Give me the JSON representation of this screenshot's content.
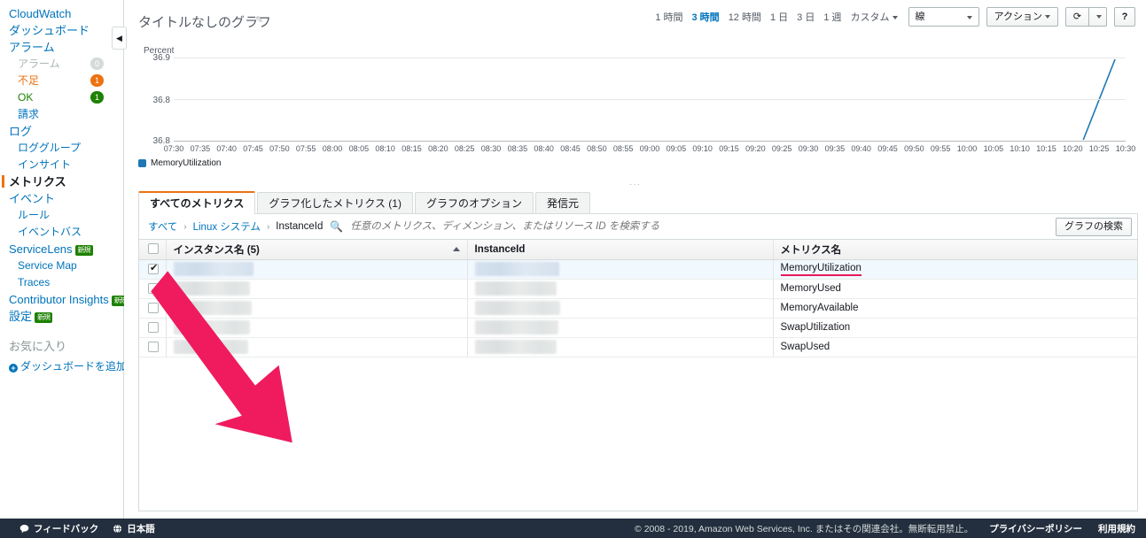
{
  "sidebar": {
    "items": [
      {
        "label": "CloudWatch",
        "level": 1,
        "style": "link"
      },
      {
        "label": "ダッシュボード",
        "level": 1,
        "style": "link"
      },
      {
        "label": "アラーム",
        "level": 1,
        "style": "link"
      },
      {
        "label": "アラーム",
        "level": 2,
        "style": "muted",
        "badge": "0",
        "badge_color": "gray"
      },
      {
        "label": "不足",
        "level": 2,
        "style": "warn",
        "badge": "1",
        "badge_color": "orange"
      },
      {
        "label": "OK",
        "level": 2,
        "style": "ok",
        "badge": "1",
        "badge_color": "green"
      },
      {
        "label": "請求",
        "level": 2,
        "style": "link"
      },
      {
        "label": "ログ",
        "level": 1,
        "style": "link"
      },
      {
        "label": "ロググループ",
        "level": 2,
        "style": "link"
      },
      {
        "label": "インサイト",
        "level": 2,
        "style": "link"
      },
      {
        "label": "メトリクス",
        "level": 1,
        "style": "current"
      },
      {
        "label": "イベント",
        "level": 1,
        "style": "link"
      },
      {
        "label": "ルール",
        "level": 2,
        "style": "link"
      },
      {
        "label": "イベントバス",
        "level": 2,
        "style": "link"
      },
      {
        "label": "ServiceLens",
        "level": 1,
        "style": "link",
        "tag": "新規"
      },
      {
        "label": "Service Map",
        "level": 2,
        "style": "link"
      },
      {
        "label": "Traces",
        "level": 2,
        "style": "link"
      },
      {
        "label": "Contributor Insights",
        "level": 1,
        "style": "link",
        "tag": "新規"
      },
      {
        "label": "設定",
        "level": 1,
        "style": "link",
        "tag": "新規"
      }
    ],
    "favorites_title": "お気に入り",
    "add_dashboard": "ダッシュボードを追加",
    "collapse_icon": "chevron-left-icon"
  },
  "header": {
    "graph_title": "タイトルなしのグラフ",
    "edit_icon": "pencil-icon",
    "ranges": [
      {
        "label": "1 時間",
        "selected": false
      },
      {
        "label": "3 時間",
        "selected": true
      },
      {
        "label": "12 時間",
        "selected": false
      },
      {
        "label": "1 日",
        "selected": false
      },
      {
        "label": "3 日",
        "selected": false
      },
      {
        "label": "1 週",
        "selected": false
      }
    ],
    "custom_label": "カスタム",
    "graph_type": "線",
    "actions_label": "アクション",
    "refresh_icon": "refresh-icon",
    "help_label": "?"
  },
  "chart_data": {
    "type": "line",
    "title": "タイトルなしのグラフ",
    "ylabel": "Percent",
    "xlabel": "",
    "ytick_labels": [
      "36.9",
      "36.8",
      "36.8"
    ],
    "ylim": [
      36.8,
      36.9
    ],
    "grid": true,
    "legend_position": "bottom-left",
    "categories": [
      "07:30",
      "07:35",
      "07:40",
      "07:45",
      "07:50",
      "07:55",
      "08:00",
      "08:05",
      "08:10",
      "08:15",
      "08:20",
      "08:25",
      "08:30",
      "08:35",
      "08:40",
      "08:45",
      "08:50",
      "08:55",
      "09:00",
      "09:05",
      "09:10",
      "09:15",
      "09:20",
      "09:25",
      "09:30",
      "09:35",
      "09:40",
      "09:45",
      "09:50",
      "09:55",
      "10:00",
      "10:05",
      "10:10",
      "10:15",
      "10:20",
      "10:25",
      "10:30"
    ],
    "series": [
      {
        "name": "MemoryUtilization",
        "color": "#1f77b4",
        "x": [
          "10:22",
          "10:28"
        ],
        "values": [
          36.8,
          36.9
        ]
      }
    ]
  },
  "legend": {
    "label": "MemoryUtilization",
    "color": "#1f77b4"
  },
  "dots": "···",
  "tabs": [
    {
      "label": "すべてのメトリクス",
      "active": true
    },
    {
      "label": "グラフ化したメトリクス (1)",
      "active": false
    },
    {
      "label": "グラフのオプション",
      "active": false
    },
    {
      "label": "発信元",
      "active": false
    }
  ],
  "breadcrumb": {
    "items": [
      "すべて",
      "Linux システム",
      "InstanceId"
    ],
    "separator": "›"
  },
  "search": {
    "icon": "search-icon",
    "placeholder": "任意のメトリクス、ディメンション、またはリソース ID を検索する",
    "value": "",
    "button_label": "グラフの検索"
  },
  "table": {
    "columns": [
      "インスタンス名 (5)",
      "InstanceId",
      "メトリクス名"
    ],
    "sort": {
      "column": "インスタンス名 (5)",
      "direction": "asc"
    },
    "rows": [
      {
        "checked": true,
        "name": "",
        "instance_id": "",
        "metric": "MemoryUtilization",
        "highlighted": true
      },
      {
        "checked": false,
        "name": "",
        "instance_id": "",
        "metric": "MemoryUsed",
        "highlighted": false
      },
      {
        "checked": false,
        "name": "",
        "instance_id": "",
        "metric": "MemoryAvailable",
        "highlighted": false
      },
      {
        "checked": false,
        "name": "",
        "instance_id": "",
        "metric": "SwapUtilization",
        "highlighted": false
      },
      {
        "checked": false,
        "name": "",
        "instance_id": "",
        "metric": "SwapUsed",
        "highlighted": false
      }
    ]
  },
  "annotation": {
    "arrow_color": "#ef1b5e",
    "shape": "pointer-arrow"
  },
  "footer": {
    "feedback": "フィードバック",
    "language": "日本語",
    "copyright": "© 2008 - 2019, Amazon Web Services, Inc. またはその関連会社。無断転用禁止。",
    "privacy": "プライバシーポリシー",
    "terms": "利用規約"
  }
}
